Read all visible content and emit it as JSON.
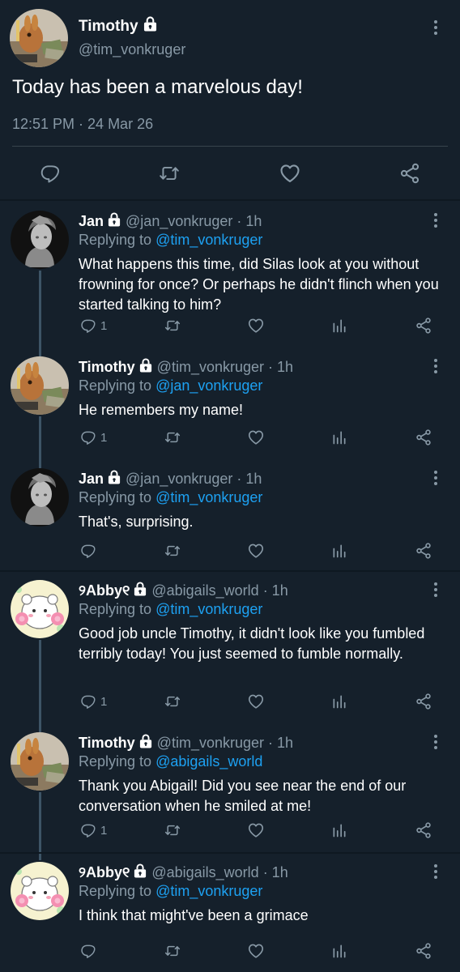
{
  "main_tweet": {
    "name": "Timothy",
    "handle": "@tim_vonkruger",
    "text": "Today has been a marvelous day!",
    "timestamp": "12:51 PM · 24 Mar 26"
  },
  "replies": [
    {
      "name": "Jan",
      "handle": "@jan_vonkruger",
      "time": "· 1h",
      "replying_prefix": "Replying to",
      "replying_to": "@tim_vonkruger",
      "text": "What happens this time, did Silas look at you without frowning for once? Or perhaps he didn't flinch when you started talking to him?",
      "reply_count": "1"
    },
    {
      "name": "Timothy",
      "handle": "@tim_vonkruger",
      "time": "· 1h",
      "replying_prefix": "Replying to",
      "replying_to": "@jan_vonkruger",
      "text": "He remembers my name!",
      "reply_count": "1"
    },
    {
      "name": "Jan",
      "handle": "@jan_vonkruger",
      "time": "· 1h",
      "replying_prefix": "Replying to",
      "replying_to": "@tim_vonkruger",
      "text": "That's, surprising.",
      "reply_count": ""
    },
    {
      "name": "୨Abby୧",
      "handle": "@abigails_world",
      "time": "· 1h",
      "replying_prefix": "Replying to",
      "replying_to": "@tim_vonkruger",
      "text": "Good job uncle Timothy, it didn't look like you fumbled terribly today! You just seemed to fumble normally.",
      "reply_count": "1"
    },
    {
      "name": "Timothy",
      "handle": "@tim_vonkruger",
      "time": "· 1h",
      "replying_prefix": "Replying to",
      "replying_to": "@abigails_world",
      "text": "Thank you Abigail! Did you see near the end of our conversation when he smiled at me!",
      "reply_count": "1"
    },
    {
      "name": "୨Abby୧",
      "handle": "@abigails_world",
      "time": "· 1h",
      "replying_prefix": "Replying to",
      "replying_to": "@tim_vonkruger",
      "text": "I think that might've been a grimace",
      "reply_count": ""
    }
  ],
  "icons": {
    "reply": "reply-icon",
    "retweet": "retweet-icon",
    "like": "heart-icon",
    "analytics": "analytics-icon",
    "share": "share-icon",
    "more": "more-icon",
    "lock": "lock-icon"
  },
  "colors": {
    "background": "#15202b",
    "text": "#ffffff",
    "muted": "#8899a6",
    "link": "#1da1f2",
    "divider": "#38444d",
    "thread_line": "#3d5466"
  }
}
